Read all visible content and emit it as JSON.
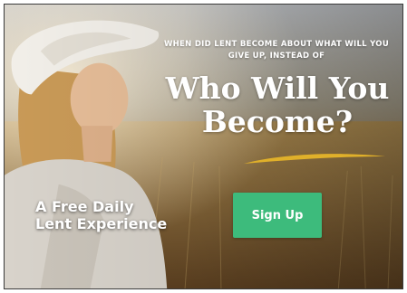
{
  "ad": {
    "question": "When did Lent become about what will you give up, instead of",
    "headline": "Who Will You Become?",
    "promo_line1": "A Free Daily",
    "promo_line2": "Lent Experience",
    "cta_label": "Sign Up"
  },
  "colors": {
    "cta_background": "#3dbb7c",
    "swash": "#e0b02a",
    "text": "#ffffff"
  }
}
